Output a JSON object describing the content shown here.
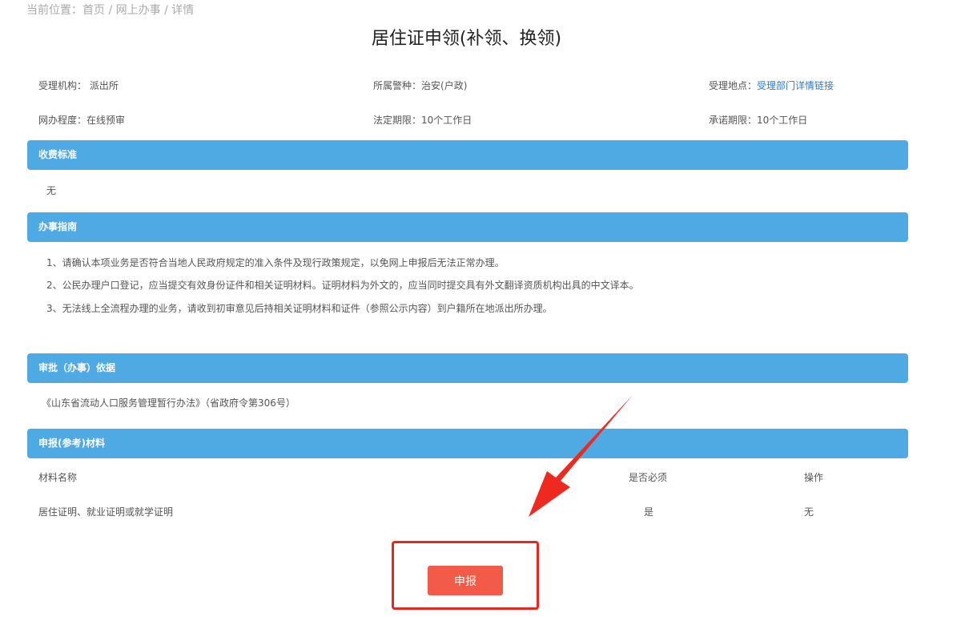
{
  "breadcrumb": "当前位置：首页 / 网上办事 / 详情",
  "title": "居住证申领(补领、换领)",
  "info": {
    "org_label": "受理机构：",
    "org": "派出所",
    "police_label": "所属警种：",
    "police": "治安(户政)",
    "place_label": "受理地点：",
    "place_link": "受理部门详情链接",
    "level_label": "网办程度：",
    "level": "在线预审",
    "legal_label": "法定期限：",
    "legal": "10个工作日",
    "promise_label": "承诺期限：",
    "promise": "10个工作日"
  },
  "sections": {
    "fee": "收费标准",
    "fee_value": "无",
    "guide": "办事指南",
    "basis": "审批（办事）依据",
    "materials": "申报(参考)材料"
  },
  "guide_items": [
    "1、请确认本项业务是否符合当地人民政府规定的准入条件及现行政策规定，以免网上申报后无法正常办理。",
    "2、公民办理户口登记，应当提交有效身份证件和相关证明材料。证明材料为外文的，应当同时提交具有外文翻译资质机构出具的中文译本。",
    "3、无法线上全流程办理的业务，请收到初审意见后持相关证明材料和证件（参照公示内容）到户籍所在地派出所办理。"
  ],
  "basis_text": "《山东省流动人口服务管理暂行办法》（省政府令第306号）",
  "table": {
    "headers": [
      "材料名称",
      "是否必须",
      "操作"
    ],
    "rows": [
      [
        "居住证明、就业证明或就学证明",
        "是",
        "无"
      ]
    ]
  },
  "submit": "申报"
}
